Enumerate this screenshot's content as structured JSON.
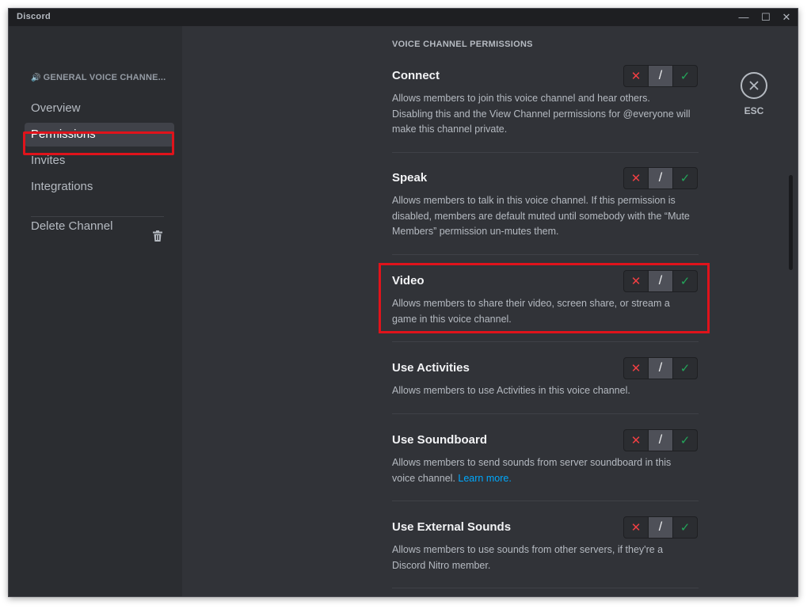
{
  "window": {
    "app_title": "Discord",
    "min": "—",
    "max": "☐",
    "close": "✕"
  },
  "sidebar": {
    "channel_header": "GENERAL VOICE CHANNE...",
    "items": [
      {
        "label": "Overview"
      },
      {
        "label": "Permissions",
        "active": true
      },
      {
        "label": "Invites"
      },
      {
        "label": "Integrations"
      }
    ],
    "delete_label": "Delete Channel"
  },
  "content": {
    "section_title": "VOICE CHANNEL PERMISSIONS",
    "esc_label": "ESC",
    "permissions": [
      {
        "name": "Connect",
        "desc": "Allows members to join this voice channel and hear others. Disabling this and the View Channel permissions for @everyone will make this channel private.",
        "state": "neutral"
      },
      {
        "name": "Speak",
        "desc": "Allows members to talk in this voice channel. If this permission is disabled, members are default muted until somebody with the “Mute Members” permission un-mutes them.",
        "state": "neutral"
      },
      {
        "name": "Video",
        "desc": "Allows members to share their video, screen share, or stream a game in this voice channel.",
        "state": "neutral"
      },
      {
        "name": "Use Activities",
        "desc": "Allows members to use Activities in this voice channel.",
        "state": "neutral"
      },
      {
        "name": "Use Soundboard",
        "desc": "Allows members to send sounds from server soundboard in this voice channel.",
        "link": "Learn more.",
        "state": "neutral"
      },
      {
        "name": "Use External Sounds",
        "desc": "Allows members to use sounds from other servers, if they're a Discord Nitro member.",
        "state": "neutral"
      }
    ],
    "toggle_glyphs": {
      "deny": "✕",
      "neutral": "/",
      "allow": "✓"
    }
  },
  "colors": {
    "accent_highlight": "#e0131b",
    "deny": "#f23f43",
    "allow": "#23a55a",
    "link": "#00a8fc"
  }
}
